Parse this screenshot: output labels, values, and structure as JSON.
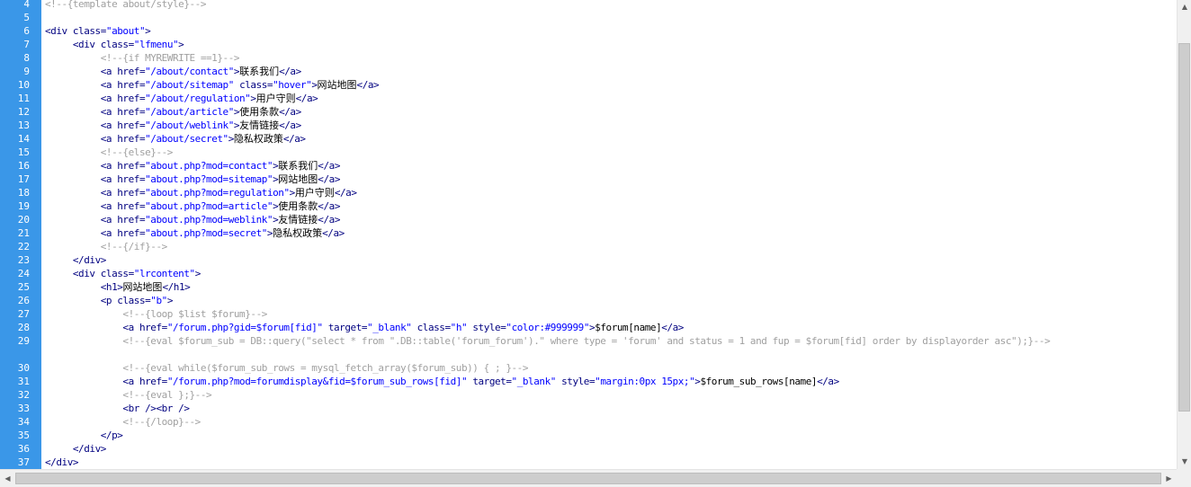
{
  "editor": {
    "lines": [
      {
        "n": "4",
        "segs": [
          {
            "c": "c",
            "t": "<!--{template about/style}-->"
          }
        ]
      },
      {
        "n": "5",
        "segs": []
      },
      {
        "n": "6",
        "segs": [
          {
            "c": "t",
            "t": "<div class="
          },
          {
            "c": "s",
            "t": "\"about\""
          },
          {
            "c": "t",
            "t": ">"
          }
        ]
      },
      {
        "n": "7",
        "segs": [
          {
            "c": "t",
            "t": "     <div class="
          },
          {
            "c": "s",
            "t": "\"lfmenu\""
          },
          {
            "c": "t",
            "t": ">"
          }
        ]
      },
      {
        "n": "8",
        "segs": [
          {
            "c": "c",
            "t": "          <!--{if MYREWRITE ==1}-->"
          }
        ]
      },
      {
        "n": "9",
        "segs": [
          {
            "c": "t",
            "t": "          <a href="
          },
          {
            "c": "s",
            "t": "\"/about/contact\""
          },
          {
            "c": "t",
            "t": ">"
          },
          {
            "c": "zh",
            "t": "联系我们"
          },
          {
            "c": "t",
            "t": "</a>"
          }
        ]
      },
      {
        "n": "10",
        "segs": [
          {
            "c": "t",
            "t": "          <a href="
          },
          {
            "c": "s",
            "t": "\"/about/sitemap\""
          },
          {
            "c": "t",
            "t": " class="
          },
          {
            "c": "s",
            "t": "\"hover\""
          },
          {
            "c": "t",
            "t": ">"
          },
          {
            "c": "zh",
            "t": "网站地图"
          },
          {
            "c": "t",
            "t": "</a>"
          }
        ]
      },
      {
        "n": "11",
        "segs": [
          {
            "c": "t",
            "t": "          <a href="
          },
          {
            "c": "s",
            "t": "\"/about/regulation\""
          },
          {
            "c": "t",
            "t": ">"
          },
          {
            "c": "zh",
            "t": "用户守则"
          },
          {
            "c": "t",
            "t": "</a>"
          }
        ]
      },
      {
        "n": "12",
        "segs": [
          {
            "c": "t",
            "t": "          <a href="
          },
          {
            "c": "s",
            "t": "\"/about/article\""
          },
          {
            "c": "t",
            "t": ">"
          },
          {
            "c": "zh",
            "t": "使用条款"
          },
          {
            "c": "t",
            "t": "</a>"
          }
        ]
      },
      {
        "n": "13",
        "segs": [
          {
            "c": "t",
            "t": "          <a href="
          },
          {
            "c": "s",
            "t": "\"/about/weblink\""
          },
          {
            "c": "t",
            "t": ">"
          },
          {
            "c": "zh",
            "t": "友情链接"
          },
          {
            "c": "t",
            "t": "</a>"
          }
        ]
      },
      {
        "n": "14",
        "segs": [
          {
            "c": "t",
            "t": "          <a href="
          },
          {
            "c": "s",
            "t": "\"/about/secret\""
          },
          {
            "c": "t",
            "t": ">"
          },
          {
            "c": "zh",
            "t": "隐私权政策"
          },
          {
            "c": "t",
            "t": "</a>"
          }
        ]
      },
      {
        "n": "15",
        "segs": [
          {
            "c": "c",
            "t": "          <!--{else}-->"
          }
        ]
      },
      {
        "n": "16",
        "segs": [
          {
            "c": "t",
            "t": "          <a href="
          },
          {
            "c": "s",
            "t": "\"about.php?mod=contact\""
          },
          {
            "c": "t",
            "t": ">"
          },
          {
            "c": "zh",
            "t": "联系我们"
          },
          {
            "c": "t",
            "t": "</a>"
          }
        ]
      },
      {
        "n": "17",
        "segs": [
          {
            "c": "t",
            "t": "          <a href="
          },
          {
            "c": "s",
            "t": "\"about.php?mod=sitemap\""
          },
          {
            "c": "t",
            "t": ">"
          },
          {
            "c": "zh",
            "t": "网站地图"
          },
          {
            "c": "t",
            "t": "</a>"
          }
        ]
      },
      {
        "n": "18",
        "segs": [
          {
            "c": "t",
            "t": "          <a href="
          },
          {
            "c": "s",
            "t": "\"about.php?mod=regulation\""
          },
          {
            "c": "t",
            "t": ">"
          },
          {
            "c": "zh",
            "t": "用户守则"
          },
          {
            "c": "t",
            "t": "</a>"
          }
        ]
      },
      {
        "n": "19",
        "segs": [
          {
            "c": "t",
            "t": "          <a href="
          },
          {
            "c": "s",
            "t": "\"about.php?mod=article\""
          },
          {
            "c": "t",
            "t": ">"
          },
          {
            "c": "zh",
            "t": "使用条款"
          },
          {
            "c": "t",
            "t": "</a>"
          }
        ]
      },
      {
        "n": "20",
        "segs": [
          {
            "c": "t",
            "t": "          <a href="
          },
          {
            "c": "s",
            "t": "\"about.php?mod=weblink\""
          },
          {
            "c": "t",
            "t": ">"
          },
          {
            "c": "zh",
            "t": "友情链接"
          },
          {
            "c": "t",
            "t": "</a>"
          }
        ]
      },
      {
        "n": "21",
        "segs": [
          {
            "c": "t",
            "t": "          <a href="
          },
          {
            "c": "s",
            "t": "\"about.php?mod=secret\""
          },
          {
            "c": "t",
            "t": ">"
          },
          {
            "c": "zh",
            "t": "隐私权政策"
          },
          {
            "c": "t",
            "t": "</a>"
          }
        ]
      },
      {
        "n": "22",
        "segs": [
          {
            "c": "c",
            "t": "          <!--{/if}-->"
          }
        ]
      },
      {
        "n": "23",
        "segs": [
          {
            "c": "t",
            "t": "     </div>"
          }
        ]
      },
      {
        "n": "24",
        "segs": [
          {
            "c": "t",
            "t": "     <div class="
          },
          {
            "c": "s",
            "t": "\"lrcontent\""
          },
          {
            "c": "t",
            "t": ">"
          }
        ]
      },
      {
        "n": "25",
        "segs": [
          {
            "c": "t",
            "t": "          <h1>"
          },
          {
            "c": "zh",
            "t": "网站地图"
          },
          {
            "c": "t",
            "t": "</h1>"
          }
        ]
      },
      {
        "n": "26",
        "segs": [
          {
            "c": "t",
            "t": "          <p class="
          },
          {
            "c": "s",
            "t": "\"b\""
          },
          {
            "c": "t",
            "t": ">"
          }
        ]
      },
      {
        "n": "27",
        "segs": [
          {
            "c": "c",
            "t": "              <!--{loop $list $forum}-->"
          }
        ]
      },
      {
        "n": "28",
        "segs": [
          {
            "c": "t",
            "t": "              <a href="
          },
          {
            "c": "s",
            "t": "\"/forum.php?gid=$forum[fid]\""
          },
          {
            "c": "t",
            "t": " target="
          },
          {
            "c": "s",
            "t": "\"_blank\""
          },
          {
            "c": "t",
            "t": " class="
          },
          {
            "c": "s",
            "t": "\"h\""
          },
          {
            "c": "t",
            "t": " style="
          },
          {
            "c": "s",
            "t": "\"color:#999999\""
          },
          {
            "c": "t",
            "t": ">"
          },
          {
            "c": "var",
            "t": "$forum[name]"
          },
          {
            "c": "t",
            "t": "</a>"
          }
        ]
      },
      {
        "n": "29",
        "tall": true,
        "segs": [
          {
            "c": "c",
            "t": "              <!--{eval $forum_sub = DB::query(\"select * from \".DB::table('forum_forum').\" where type = 'forum' and status = 1 and fup = $forum[fid] order by displayorder asc\");}-->"
          }
        ]
      },
      {
        "n": "30",
        "segs": [
          {
            "c": "c",
            "t": "              <!--{eval while($forum_sub_rows = mysql_fetch_array($forum_sub)) { ; }-->"
          }
        ]
      },
      {
        "n": "31",
        "segs": [
          {
            "c": "t",
            "t": "              <a href="
          },
          {
            "c": "s",
            "t": "\"/forum.php?mod=forumdisplay&fid=$forum_sub_rows[fid]\""
          },
          {
            "c": "t",
            "t": " target="
          },
          {
            "c": "s",
            "t": "\"_blank\""
          },
          {
            "c": "t",
            "t": " style="
          },
          {
            "c": "s",
            "t": "\"margin:0px 15px;\""
          },
          {
            "c": "t",
            "t": ">"
          },
          {
            "c": "var",
            "t": "$forum_sub_rows[name]"
          },
          {
            "c": "t",
            "t": "</a>"
          }
        ]
      },
      {
        "n": "32",
        "segs": [
          {
            "c": "c",
            "t": "              <!--{eval };}-->"
          }
        ]
      },
      {
        "n": "33",
        "segs": [
          {
            "c": "t",
            "t": "              <br /><br />"
          }
        ]
      },
      {
        "n": "34",
        "segs": [
          {
            "c": "c",
            "t": "              <!--{/loop}-->"
          }
        ]
      },
      {
        "n": "35",
        "segs": [
          {
            "c": "t",
            "t": "          </p>"
          }
        ]
      },
      {
        "n": "36",
        "segs": [
          {
            "c": "t",
            "t": "     </div>"
          }
        ]
      },
      {
        "n": "37",
        "segs": [
          {
            "c": "t",
            "t": "</div>"
          }
        ]
      }
    ]
  },
  "scrollbars": {
    "up_arrow": "▲",
    "down_arrow": "▼",
    "left_arrow": "◀",
    "right_arrow": "▶"
  },
  "colors": {
    "gutter": "#3a97e8",
    "tag": "#000080",
    "string": "#0000ff",
    "comment": "#a0a0a0"
  }
}
